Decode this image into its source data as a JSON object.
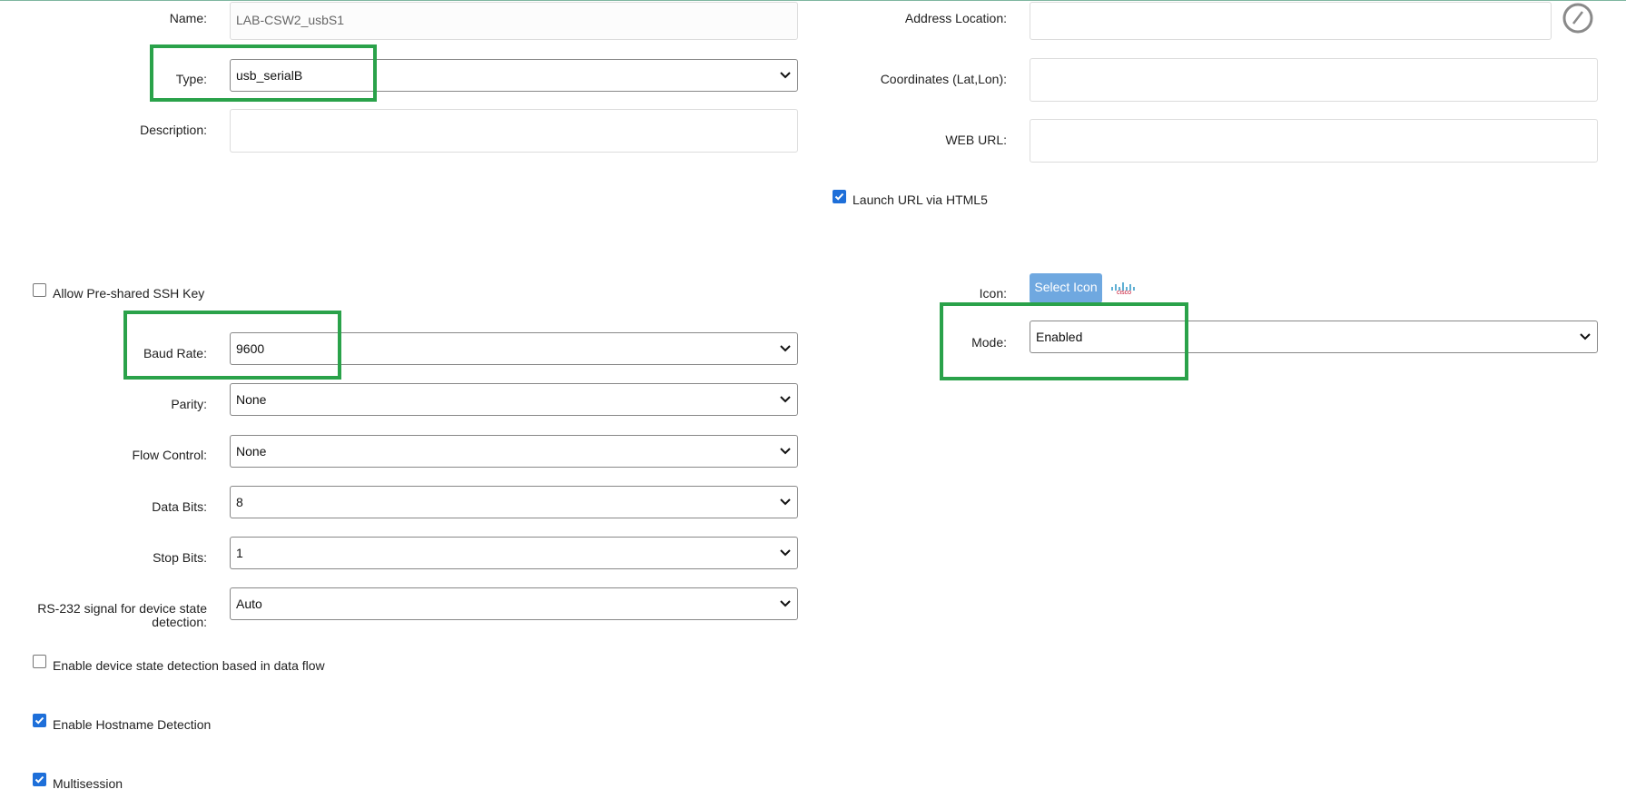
{
  "fields": {
    "name": {
      "label": "Name:",
      "value": "LAB-CSW2_usbS1"
    },
    "type": {
      "label": "Type:",
      "value": "usb_serialB"
    },
    "description": {
      "label": "Description:",
      "value": ""
    },
    "address_location": {
      "label": "Address Location:",
      "value": ""
    },
    "coordinates": {
      "label": "Coordinates (Lat,Lon):",
      "value": ""
    },
    "web_url": {
      "label": "WEB URL:",
      "value": ""
    },
    "icon": {
      "label": "Icon:",
      "button": "Select Icon",
      "logo_text": "cisco"
    },
    "mode": {
      "label": "Mode:",
      "value": "Enabled"
    },
    "baud_rate": {
      "label": "Baud Rate:",
      "value": "9600"
    },
    "parity": {
      "label": "Parity:",
      "value": "None"
    },
    "flow_control": {
      "label": "Flow Control:",
      "value": "None"
    },
    "data_bits": {
      "label": "Data Bits:",
      "value": "8"
    },
    "stop_bits": {
      "label": "Stop Bits:",
      "value": "1"
    },
    "rs232": {
      "label_line1": "RS-232 signal for device state",
      "label_line2": "detection:",
      "value": "Auto"
    }
  },
  "checkboxes": {
    "launch_url_html5": {
      "label": "Launch URL via HTML5",
      "checked": true
    },
    "allow_ssh_key": {
      "label": "Allow Pre-shared SSH Key",
      "checked": false
    },
    "state_detection_data_flow": {
      "label": "Enable device state detection based in data flow",
      "checked": false
    },
    "hostname_detection": {
      "label": "Enable Hostname Detection",
      "checked": true
    },
    "multisession": {
      "label": "Multisession",
      "checked": true
    }
  },
  "icons": {
    "locate": "compass-icon",
    "dropdown": "chevron-down-icon",
    "check": "check-icon",
    "brand": "cisco-logo-icon"
  },
  "colors": {
    "highlight": "#2aa24a",
    "checkbox": "#1e6fd9",
    "button": "#6fa8e0"
  }
}
